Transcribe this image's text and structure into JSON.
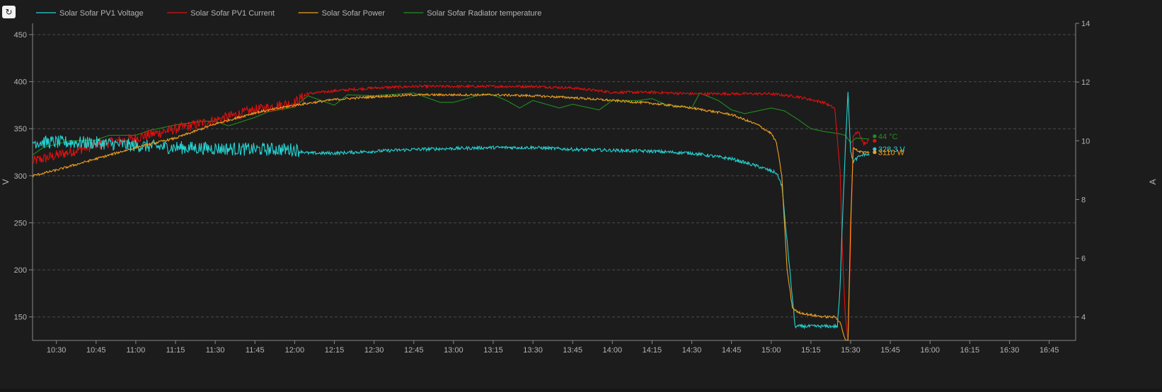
{
  "refresh_icon": "↻",
  "colors": {
    "background": "#1c1c1c",
    "grid": "#4a4a4a",
    "axis": "#888888",
    "text": "#b4b4b4",
    "voltage": "#26d4d4",
    "current": "#e01010",
    "power": "#f0a020",
    "temperature": "#1f8f1f"
  },
  "legend": [
    {
      "key": "voltage",
      "label": "Solar Sofar PV1 Voltage",
      "color": "#26d4d4"
    },
    {
      "key": "current",
      "label": "Solar Sofar PV1 Current",
      "color": "#e01010"
    },
    {
      "key": "power",
      "label": "Solar Sofar Power",
      "color": "#f0a020"
    },
    {
      "key": "temperature",
      "label": "Solar Sofar Radiator temperature",
      "color": "#1f8f1f"
    }
  ],
  "chart_data": {
    "type": "line",
    "title": "",
    "legend_position": "top-left",
    "grid": true,
    "xlabel": "",
    "x_ticks": [
      "10:30",
      "10:45",
      "11:00",
      "11:15",
      "11:30",
      "11:45",
      "12:00",
      "12:15",
      "12:30",
      "12:45",
      "13:00",
      "13:15",
      "13:30",
      "13:45",
      "14:00",
      "14:15",
      "14:30",
      "14:45",
      "15:00",
      "15:15",
      "15:30",
      "15:45",
      "16:00",
      "16:15",
      "16:30",
      "16:45"
    ],
    "xlim": [
      "10:21",
      "16:55"
    ],
    "y_left": {
      "label": "V",
      "ticks": [
        150,
        200,
        250,
        300,
        350,
        400,
        450
      ],
      "ylim": [
        125,
        462
      ]
    },
    "y_right": {
      "label": "A",
      "ticks": [
        4,
        6,
        8,
        10,
        12,
        14
      ],
      "ylim": [
        3.2,
        14
      ]
    },
    "series": [
      {
        "name": "Solar Sofar PV1 Voltage",
        "axis": "left",
        "unit": "V",
        "color": "#26d4d4",
        "noise": 7,
        "noise_until": "12:02",
        "points": [
          [
            "10:21",
            336
          ],
          [
            "10:45",
            335
          ],
          [
            "11:00",
            332
          ],
          [
            "11:15",
            330
          ],
          [
            "11:30",
            329
          ],
          [
            "11:45",
            328
          ],
          [
            "12:00",
            328
          ],
          [
            "12:05",
            324
          ],
          [
            "12:15",
            324
          ],
          [
            "12:30",
            326
          ],
          [
            "12:45",
            328
          ],
          [
            "13:00",
            329
          ],
          [
            "13:15",
            330
          ],
          [
            "13:30",
            330
          ],
          [
            "13:45",
            328
          ],
          [
            "14:00",
            327
          ],
          [
            "14:15",
            326
          ],
          [
            "14:30",
            324
          ],
          [
            "14:45",
            318
          ],
          [
            "14:55",
            310
          ],
          [
            "15:02",
            303
          ],
          [
            "15:04",
            290
          ],
          [
            "15:06",
            230
          ],
          [
            "15:08",
            170
          ],
          [
            "15:09",
            140
          ],
          [
            "15:15",
            140
          ],
          [
            "15:20",
            140
          ],
          [
            "15:25",
            140
          ],
          [
            "15:26",
            180
          ],
          [
            "15:27",
            260
          ],
          [
            "15:28",
            330
          ],
          [
            "15:29",
            390
          ],
          [
            "15:30",
            325
          ],
          [
            "15:31",
            315
          ],
          [
            "15:33",
            320
          ],
          [
            "15:35",
            323
          ],
          [
            "15:37",
            322
          ]
        ],
        "end_label": "328.3 V",
        "end_value": 328.3
      },
      {
        "name": "Solar Sofar PV1 Current",
        "axis": "right",
        "unit": "A",
        "color": "#e01010",
        "noise": 0.18,
        "noise_until": "12:05",
        "points": [
          [
            "10:21",
            9.3
          ],
          [
            "10:30",
            9.5
          ],
          [
            "10:45",
            9.85
          ],
          [
            "11:00",
            10.1
          ],
          [
            "11:15",
            10.4
          ],
          [
            "11:30",
            10.7
          ],
          [
            "11:45",
            11.05
          ],
          [
            "12:00",
            11.3
          ],
          [
            "12:05",
            11.6
          ],
          [
            "12:15",
            11.7
          ],
          [
            "12:30",
            11.8
          ],
          [
            "12:45",
            11.85
          ],
          [
            "13:00",
            11.85
          ],
          [
            "13:15",
            11.85
          ],
          [
            "13:30",
            11.85
          ],
          [
            "13:45",
            11.8
          ],
          [
            "14:00",
            11.65
          ],
          [
            "14:15",
            11.65
          ],
          [
            "14:30",
            11.6
          ],
          [
            "14:45",
            11.6
          ],
          [
            "15:00",
            11.6
          ],
          [
            "15:10",
            11.5
          ],
          [
            "15:20",
            11.3
          ],
          [
            "15:24",
            11.1
          ],
          [
            "15:26",
            9.0
          ],
          [
            "15:27",
            6.0
          ],
          [
            "15:28",
            4.0
          ],
          [
            "15:29",
            3.2
          ],
          [
            "15:30",
            6.5
          ],
          [
            "15:31",
            10.2
          ],
          [
            "15:33",
            10.3
          ],
          [
            "15:35",
            9.9
          ],
          [
            "15:37",
            10.0
          ]
        ],
        "end_label": "",
        "end_value": 10.0
      },
      {
        "name": "Solar Sofar Power",
        "axis": "left",
        "unit": "W",
        "color": "#f0a020",
        "noise": 1.2,
        "noise_until": "16:00",
        "points": [
          [
            "10:21",
            300
          ],
          [
            "10:30",
            306
          ],
          [
            "10:45",
            318
          ],
          [
            "11:00",
            330
          ],
          [
            "11:15",
            340
          ],
          [
            "11:30",
            355
          ],
          [
            "11:45",
            367
          ],
          [
            "12:00",
            375
          ],
          [
            "12:15",
            381
          ],
          [
            "12:30",
            384
          ],
          [
            "12:45",
            386
          ],
          [
            "13:00",
            386
          ],
          [
            "13:15",
            386
          ],
          [
            "13:30",
            385
          ],
          [
            "13:45",
            383
          ],
          [
            "14:00",
            380
          ],
          [
            "14:15",
            377
          ],
          [
            "14:30",
            372
          ],
          [
            "14:45",
            365
          ],
          [
            "14:55",
            354
          ],
          [
            "15:00",
            345
          ],
          [
            "15:02",
            335
          ],
          [
            "15:04",
            300
          ],
          [
            "15:06",
            200
          ],
          [
            "15:08",
            160
          ],
          [
            "15:10",
            155
          ],
          [
            "15:15",
            152
          ],
          [
            "15:20",
            150
          ],
          [
            "15:24",
            150
          ],
          [
            "15:26",
            145
          ],
          [
            "15:28",
            125
          ],
          [
            "15:29",
            125
          ],
          [
            "15:30",
            250
          ],
          [
            "15:31",
            330
          ],
          [
            "15:33",
            326
          ],
          [
            "15:35",
            325
          ],
          [
            "15:37",
            325
          ]
        ],
        "end_label": "3110 W",
        "end_value": 3110
      },
      {
        "name": "Solar Sofar Radiator temperature",
        "axis": "left",
        "unit": "°C",
        "color": "#1f8f1f",
        "noise": 0,
        "noise_until": "10:21",
        "points": [
          [
            "10:21",
            322
          ],
          [
            "10:25",
            330
          ],
          [
            "10:35",
            337
          ],
          [
            "10:45",
            338
          ],
          [
            "10:50",
            343
          ],
          [
            "11:00",
            343
          ],
          [
            "11:05",
            348
          ],
          [
            "11:15",
            354
          ],
          [
            "11:25",
            358
          ],
          [
            "11:30",
            358
          ],
          [
            "11:35",
            353
          ],
          [
            "11:45",
            362
          ],
          [
            "11:50",
            368
          ],
          [
            "12:00",
            373
          ],
          [
            "12:05",
            385
          ],
          [
            "12:10",
            380
          ],
          [
            "12:15",
            375
          ],
          [
            "12:20",
            386
          ],
          [
            "12:30",
            385
          ],
          [
            "12:40",
            387
          ],
          [
            "12:45",
            388
          ],
          [
            "12:55",
            378
          ],
          [
            "13:00",
            378
          ],
          [
            "13:05",
            382
          ],
          [
            "13:10",
            386
          ],
          [
            "13:15",
            386
          ],
          [
            "13:20",
            380
          ],
          [
            "13:25",
            372
          ],
          [
            "13:30",
            380
          ],
          [
            "13:40",
            372
          ],
          [
            "13:45",
            376
          ],
          [
            "13:55",
            370
          ],
          [
            "14:00",
            380
          ],
          [
            "14:10",
            380
          ],
          [
            "14:15",
            382
          ],
          [
            "14:20",
            376
          ],
          [
            "14:30",
            372
          ],
          [
            "14:33",
            388
          ],
          [
            "14:40",
            380
          ],
          [
            "14:45",
            370
          ],
          [
            "14:50",
            366
          ],
          [
            "15:00",
            372
          ],
          [
            "15:05",
            369
          ],
          [
            "15:10",
            360
          ],
          [
            "15:15",
            350
          ],
          [
            "15:20",
            347
          ],
          [
            "15:25",
            345
          ],
          [
            "15:28",
            343
          ],
          [
            "15:30",
            335
          ],
          [
            "15:32",
            340
          ],
          [
            "15:37",
            339
          ]
        ],
        "end_label": "44 °C",
        "end_value": 44
      }
    ]
  }
}
